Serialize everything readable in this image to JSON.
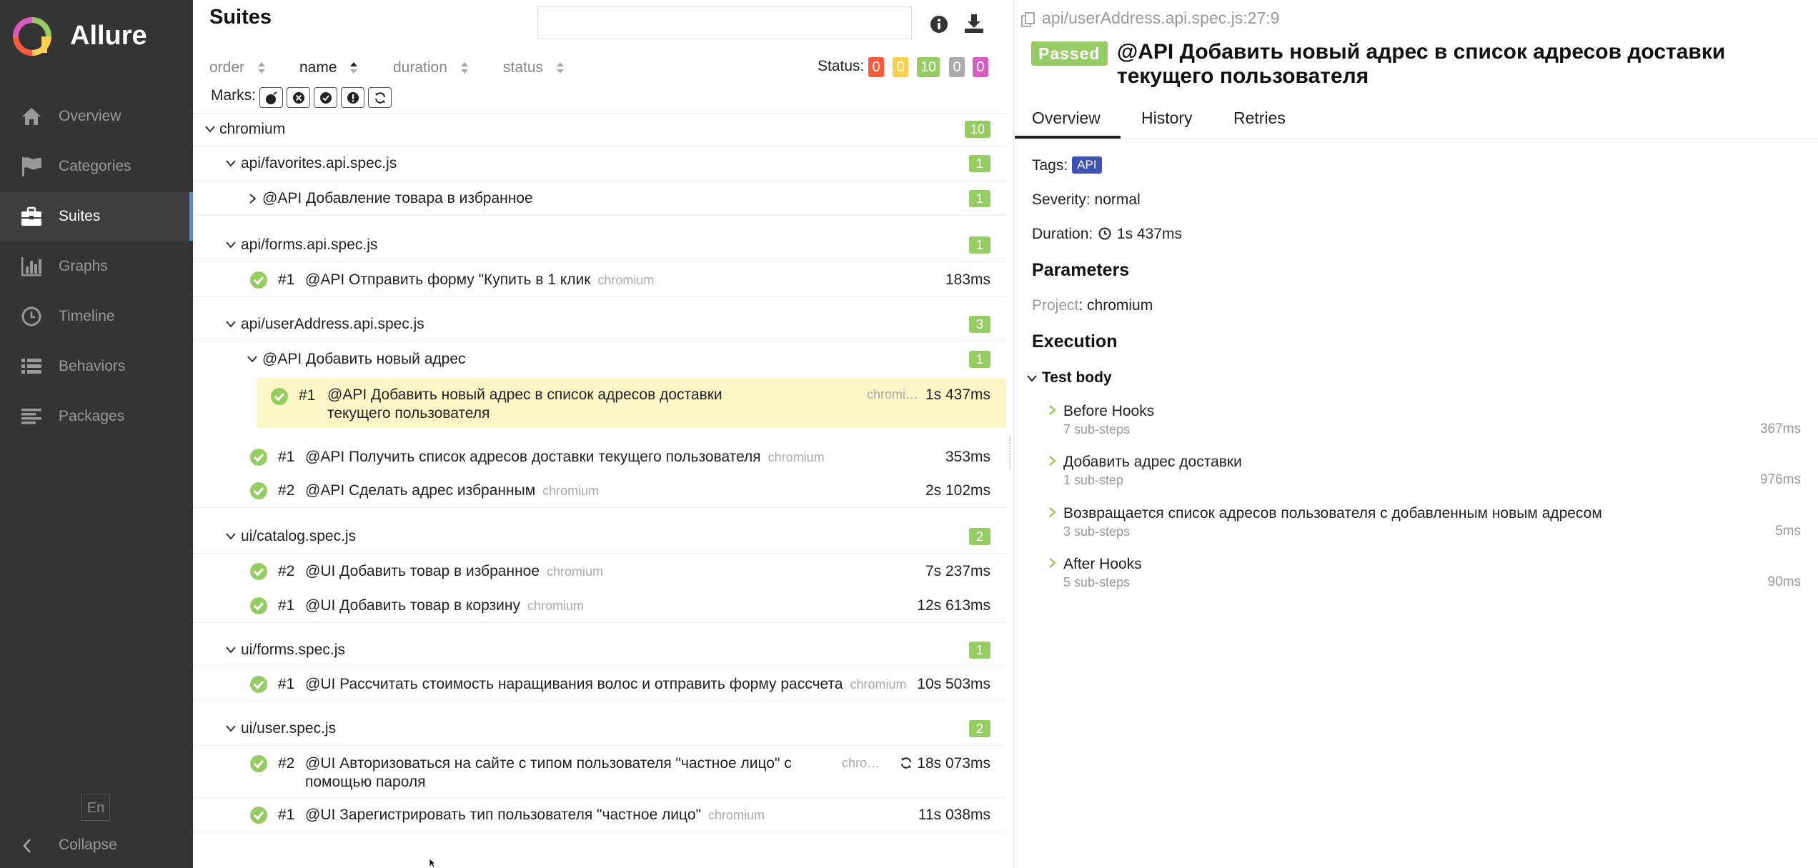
{
  "sidebar": {
    "app_title": "Allure",
    "items": [
      {
        "label": "Overview",
        "icon": "home-icon"
      },
      {
        "label": "Categories",
        "icon": "flag-icon"
      },
      {
        "label": "Suites",
        "icon": "briefcase-icon"
      },
      {
        "label": "Graphs",
        "icon": "bar-chart-icon"
      },
      {
        "label": "Timeline",
        "icon": "clock-icon"
      },
      {
        "label": "Behaviors",
        "icon": "list-icon"
      },
      {
        "label": "Packages",
        "icon": "align-left-icon"
      }
    ],
    "active_item": "Suites",
    "lang": "En",
    "collapse_label": "Collapse"
  },
  "suites": {
    "title": "Suites",
    "search": {
      "value": "",
      "placeholder": ""
    },
    "sort": [
      "order",
      "name",
      "duration",
      "status"
    ],
    "active_sort": "name",
    "status_label": "Status:",
    "status_counts": [
      {
        "value": "0",
        "color": "#fd5a3e"
      },
      {
        "value": "0",
        "color": "#ffd050"
      },
      {
        "value": "10",
        "color": "#97cc64"
      },
      {
        "value": "0",
        "color": "#aaaaaa"
      },
      {
        "value": "0",
        "color": "#d35ebe"
      }
    ],
    "marks_label": "Marks:",
    "marks": [
      "flaky-icon",
      "new-failed-icon",
      "new-passed-icon",
      "new-broken-icon",
      "retries-icon"
    ],
    "tree": {
      "root": {
        "name": "chromium",
        "count": "10"
      },
      "groups": [
        {
          "name": "api/favorites.api.spec.js",
          "count": "1"
        },
        {
          "name": "api/forms.api.spec.js",
          "count": "1"
        },
        {
          "name": "api/userAddress.api.spec.js",
          "count": "3"
        },
        {
          "name": "ui/catalog.spec.js",
          "count": "2"
        },
        {
          "name": "ui/forms.spec.js",
          "count": "1"
        },
        {
          "name": "ui/user.spec.js",
          "count": "2"
        }
      ],
      "subgroups": [
        {
          "name": "@API Добавление товара в избранное",
          "count": "1"
        },
        {
          "name": "@API Добавить новый адрес",
          "count": "1"
        }
      ],
      "tests": [
        {
          "num": "#1",
          "name": "@API Отправить форму \"Купить в 1 клик",
          "param": "chromium",
          "duration": "183ms"
        },
        {
          "num": "#1",
          "name": "@API Добавить новый адрес в список адресов доставки текущего пользователя",
          "param": "chromi…",
          "duration": "1s 437ms"
        },
        {
          "num": "#1",
          "name": "@API Получить список адресов доставки текущего пользователя",
          "param": "chromium",
          "duration": "353ms"
        },
        {
          "num": "#2",
          "name": "@API Сделать адрес избранным",
          "param": "chromium",
          "duration": "2s 102ms"
        },
        {
          "num": "#2",
          "name": "@UI Добавить товар в избранное",
          "param": "chromium",
          "duration": "7s 237ms"
        },
        {
          "num": "#1",
          "name": "@UI Добавить товар в корзину",
          "param": "chromium",
          "duration": "12s 613ms"
        },
        {
          "num": "#1",
          "name": "@UI Рассчитать стоимость наращивания волос и отправить форму рассчета",
          "param": "chromium",
          "duration": "10s 503ms"
        },
        {
          "num": "#2",
          "name": "@UI Авторизоваться на сайте с типом пользователя \"частное лицо\" с помощью пароля",
          "param": "chro…",
          "duration": "18s 073ms"
        },
        {
          "num": "#1",
          "name": "@UI Зарегистрировать тип пользователя \"частное лицо\"",
          "param": "chromium",
          "duration": "11s 038ms"
        }
      ]
    }
  },
  "detail": {
    "path": "api/userAddress.api.spec.js:27:9",
    "status": "Passed",
    "title": "@API Добавить новый адрес в список адресов доставки текущего пользователя",
    "tabs": [
      "Overview",
      "History",
      "Retries"
    ],
    "active_tab": "Overview",
    "tags_label": "Tags:",
    "tag": "API",
    "severity_label": "Severity:",
    "severity": "normal",
    "duration_label": "Duration:",
    "duration": "1s 437ms",
    "parameters_heading": "Parameters",
    "param_name": "Project",
    "param_value": "chromium",
    "execution_heading": "Execution",
    "test_body_label": "Test body",
    "steps": [
      {
        "name": "Before Hooks",
        "sub": "7 sub-steps",
        "duration": "367ms"
      },
      {
        "name": "Добавить адрес доставки",
        "sub": "1 sub-step",
        "duration": "976ms"
      },
      {
        "name": "Возвращается список адресов пользователя с добавленным новым адресом",
        "sub": "3 sub-steps",
        "duration": "5ms"
      },
      {
        "name": "After Hooks",
        "sub": "5 sub-steps",
        "duration": "90ms"
      }
    ]
  },
  "colors": {
    "passed": "#97cc64",
    "sidebar_bg": "#343434",
    "accent": "#4d8fd9",
    "tag_bg": "#3f51b5",
    "selected_row": "#fdf6c6"
  }
}
